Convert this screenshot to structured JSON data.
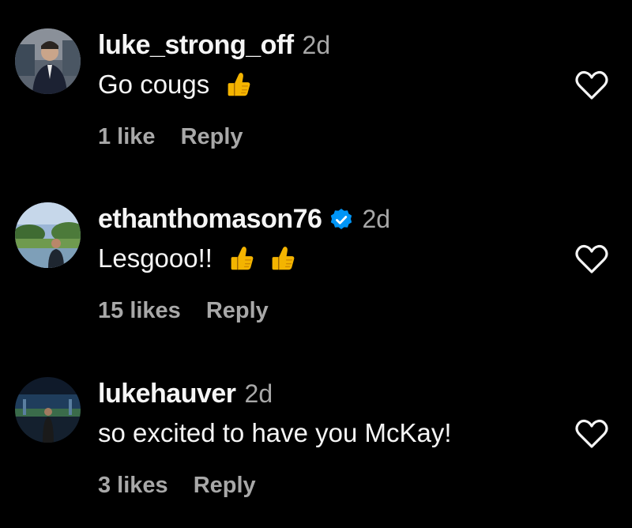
{
  "comments": [
    {
      "username": "luke_strong_off",
      "verified": false,
      "time": "2d",
      "text": "Go cougs",
      "emojis": [
        "thumbs-up-emoji"
      ],
      "likes": "1 like",
      "reply_label": "Reply"
    },
    {
      "username": "ethanthomason76",
      "verified": true,
      "time": "2d",
      "text": "Lesgooo!!",
      "emojis": [
        "thumbs-up-emoji",
        "thumbs-up-emoji"
      ],
      "likes": "15 likes",
      "reply_label": "Reply"
    },
    {
      "username": "lukehauver",
      "verified": false,
      "time": "2d",
      "text": "so excited to have you McKay!",
      "emojis": [],
      "likes": "3 likes",
      "reply_label": "Reply"
    }
  ],
  "icons": {
    "like": "heart-outline-icon",
    "verified": "verified-badge-icon"
  },
  "colors": {
    "background": "#000000",
    "primary_text": "#f5f5f5",
    "secondary_text": "#a8a8a8",
    "verified_blue": "#0095f6",
    "emoji_yellow": "#f4b400"
  }
}
